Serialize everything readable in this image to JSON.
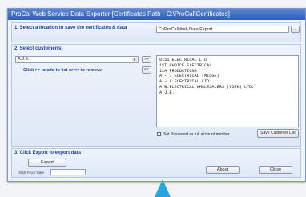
{
  "window": {
    "title": "ProCal Web Service Data Exporter  [Certificates Path - C:\\ProCal\\Certificates]"
  },
  "location": {
    "step_label": "1. Select a location to save the certificates & data",
    "path_value": "C:\\ProCal\\Web Data\\Export",
    "browse_label": "..."
  },
  "customers": {
    "step_label": "2. Select customer(s)",
    "selected_value": "A.J.E.",
    "add_button": ">>",
    "remove_button": "<<",
    "hint": "Click >> to add to list or << to remove",
    "list": [
      "0151 ELECTRICAL LTD",
      "1ST CHOICE ELECTRICAL",
      "1LA PRODUCTIONS",
      "A - J ELECTRICAL (MIDGE)",
      "A - L ELECTRICAL LTD",
      "A.B.ELECTRICAL WHOLESALERS (YORK) LTD.",
      "A.J.E."
    ],
    "password_checked": true,
    "password_label": "Set Password as full account number",
    "save_list_button": "Save Customer List"
  },
  "export": {
    "step_label": "3. Click Export to export data",
    "export_button": "Export",
    "from_date_label": "Start From Date",
    "from_date_value": ""
  },
  "footer": {
    "about_button": "About",
    "close_button": "Close"
  },
  "colors": {
    "accent_arrow": "#2aa3e3",
    "title_bar": "#2f5db5",
    "step_text": "#1d3f9b"
  }
}
